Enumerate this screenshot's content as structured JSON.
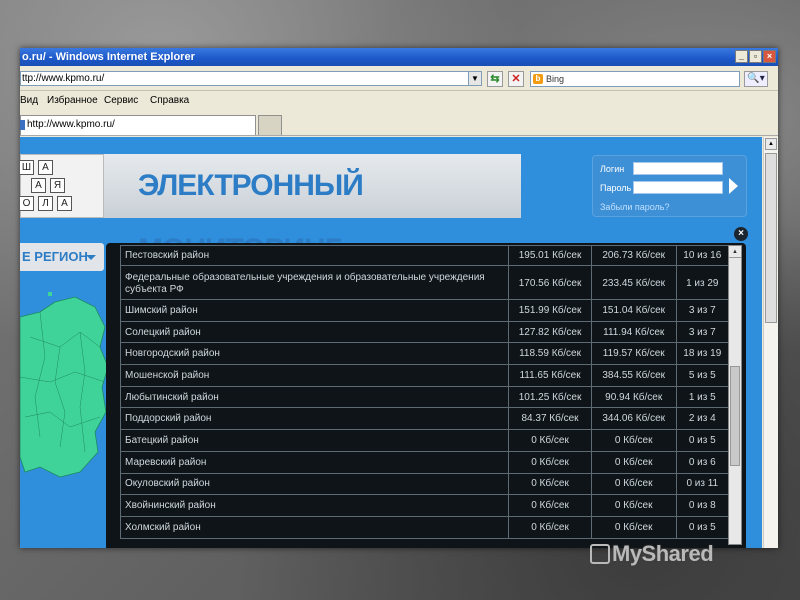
{
  "window": {
    "title": "о.ru/ - Windows Internet Explorer",
    "buttons": [
      "_",
      "▫",
      "×"
    ]
  },
  "address_bar": {
    "url": "ttp://www.kpmo.ru/",
    "search_engine": "Bing"
  },
  "menu": [
    "Вид",
    "Избранное",
    "Сервис",
    "Справка"
  ],
  "tab": {
    "label": "http://www.kpmo.ru/"
  },
  "site": {
    "logo_letters": [
      "Ш",
      "А",
      "А",
      "Я",
      "О",
      "Л",
      "А"
    ],
    "banner_text": "ЭЛЕКТРОННЫЙ МОНИТОРИНГ",
    "login": {
      "login_label": "Логин",
      "password_label": "Пароль",
      "forgot_link": "Забыли пароль?"
    },
    "region_selector": "Е РЕГИОН"
  },
  "table": {
    "rows": [
      {
        "name": "Пестовский район",
        "upload": "195.01 Кб/сек",
        "download": "206.73 Кб/сек",
        "count": "10 из 16"
      },
      {
        "name": "Федеральные образовательные учреждения и образовательные учреждения субъекта РФ",
        "upload": "170.56 Кб/сек",
        "download": "233.45 Кб/сек",
        "count": "1 из 29"
      },
      {
        "name": "Шимский район",
        "upload": "151.99 Кб/сек",
        "download": "151.04 Кб/сек",
        "count": "3 из 7"
      },
      {
        "name": "Солецкий район",
        "upload": "127.82 Кб/сек",
        "download": "111.94 Кб/сек",
        "count": "3 из 7"
      },
      {
        "name": "Новгородский район",
        "upload": "118.59 Кб/сек",
        "download": "119.57 Кб/сек",
        "count": "18 из 19"
      },
      {
        "name": "Мошенской район",
        "upload": "111.65 Кб/сек",
        "download": "384.55 Кб/сек",
        "count": "5 из 5"
      },
      {
        "name": "Любытинский район",
        "upload": "101.25 Кб/сек",
        "download": "90.94 Кб/сек",
        "count": "1 из 5"
      },
      {
        "name": "Поддорский район",
        "upload": "84.37 Кб/сек",
        "download": "344.06 Кб/сек",
        "count": "2 из 4"
      },
      {
        "name": "Батецкий район",
        "upload": "0 Кб/сек",
        "download": "0 Кб/сек",
        "count": "0 из 5"
      },
      {
        "name": "Маревский район",
        "upload": "0 Кб/сек",
        "download": "0 Кб/сек",
        "count": "0 из 6"
      },
      {
        "name": "Окуловский район",
        "upload": "0 Кб/сек",
        "download": "0 Кб/сек",
        "count": "0 из 11"
      },
      {
        "name": "Хвойнинский район",
        "upload": "0 Кб/сек",
        "download": "0 Кб/сек",
        "count": "0 из 8"
      },
      {
        "name": "Холмский район",
        "upload": "0 Кб/сек",
        "download": "0 Кб/сек",
        "count": "0 из 5"
      }
    ]
  },
  "watermark": "MyShared",
  "colors": {
    "site_bg": "#2f8fdc",
    "panel_bg": "#0e1418",
    "map_fill": "#3fd39a",
    "titlebar": "#1c58c8"
  }
}
